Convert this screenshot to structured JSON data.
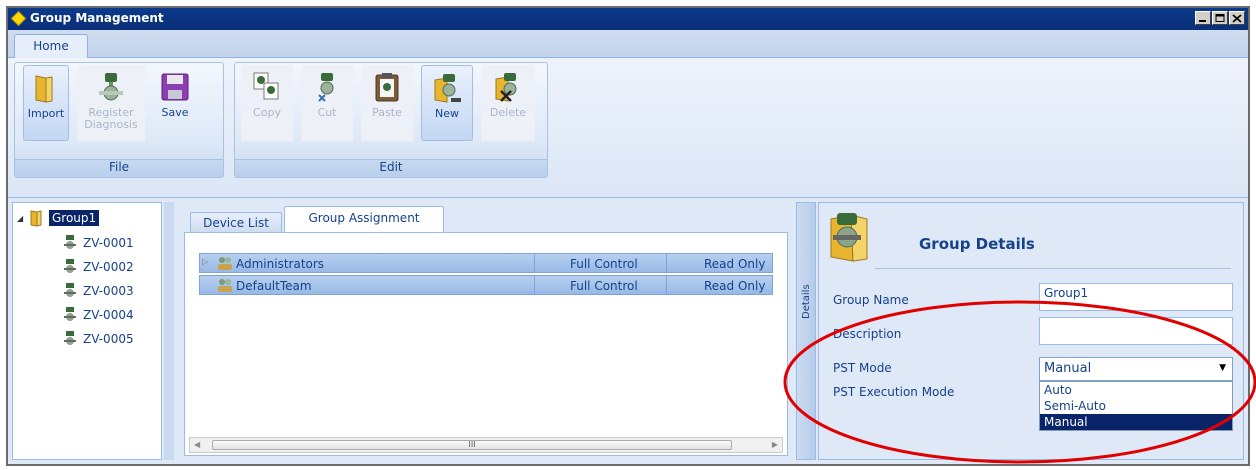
{
  "window": {
    "title": "Group Management"
  },
  "ribbon": {
    "tab": "Home",
    "groups": {
      "file": {
        "label": "File",
        "import": "Import",
        "register_diagnosis": "Register Diagnosis",
        "save": "Save"
      },
      "edit": {
        "label": "Edit",
        "copy": "Copy",
        "cut": "Cut",
        "paste": "Paste",
        "new": "New",
        "delete": "Delete"
      }
    }
  },
  "tree": {
    "root": "Group1",
    "items": [
      "ZV-0001",
      "ZV-0002",
      "ZV-0003",
      "ZV-0004",
      "ZV-0005"
    ]
  },
  "center": {
    "tabs": {
      "device_list": "Device List",
      "group_assignment": "Group Assignment"
    },
    "rows": [
      {
        "name": "Administrators",
        "control": "Full Control",
        "access": "Read Only"
      },
      {
        "name": "DefaultTeam",
        "control": "Full Control",
        "access": "Read Only"
      }
    ],
    "scroll_thumb": "III"
  },
  "splitter": {
    "label": "Details"
  },
  "details": {
    "title": "Group Details",
    "group_name_label": "Group Name",
    "group_name_value": "Group1",
    "description_label": "Description",
    "description_value": "",
    "pst_mode_label": "PST Mode",
    "pst_mode_value": "Manual",
    "pst_exec_label": "PST Execution Mode",
    "options": [
      "Auto",
      "Semi-Auto",
      "Manual"
    ]
  },
  "colors": {
    "title_bar": "#0b3a8a",
    "selection": "#0a246a",
    "annotation": "#e00000",
    "text": "#15428b"
  },
  "icons": [
    "app-diamond-icon",
    "folder-icon",
    "valve-icon",
    "floppy-icon",
    "clipboard-icon",
    "team-icon"
  ]
}
